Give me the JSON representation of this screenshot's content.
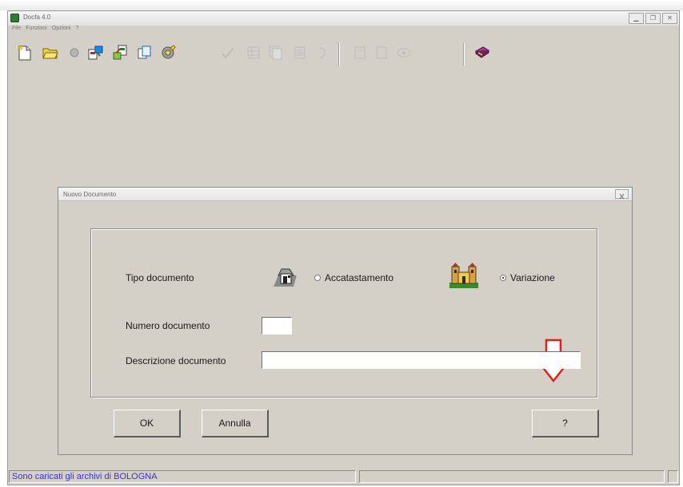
{
  "window": {
    "title": "Docfa 4.0"
  },
  "menu": [
    "File",
    "Funzioni",
    "Opzioni",
    "?"
  ],
  "toolbar": {
    "icons": [
      "new-document-icon",
      "open-folder-icon",
      "disabled-circle-icon",
      "import-icon",
      "export-icon",
      "copy-icon",
      "settings-icon",
      "check-icon",
      "grid-icon",
      "pages-icon",
      "list-icon",
      "undo-icon",
      "form-icon",
      "page-icon",
      "eye-icon",
      "book-icon"
    ]
  },
  "dialog": {
    "title": "Nuovo Documento",
    "tipo_label": "Tipo documento",
    "accatastamento_label": "Accatastamento",
    "variazione_label": "Variazione",
    "selected": "Variazione",
    "numero_label": "Numero documento",
    "numero_value": "",
    "descrizione_label": "Descrizione documento",
    "descrizione_value": "",
    "ok_label": "OK",
    "annulla_label": "Annulla",
    "help_label": "?"
  },
  "status": {
    "text": "Sono caricati gli archivi di  BOLOGNA"
  },
  "colors": {
    "status_text": "#3a2ee0",
    "arrow": "#e0211b"
  }
}
